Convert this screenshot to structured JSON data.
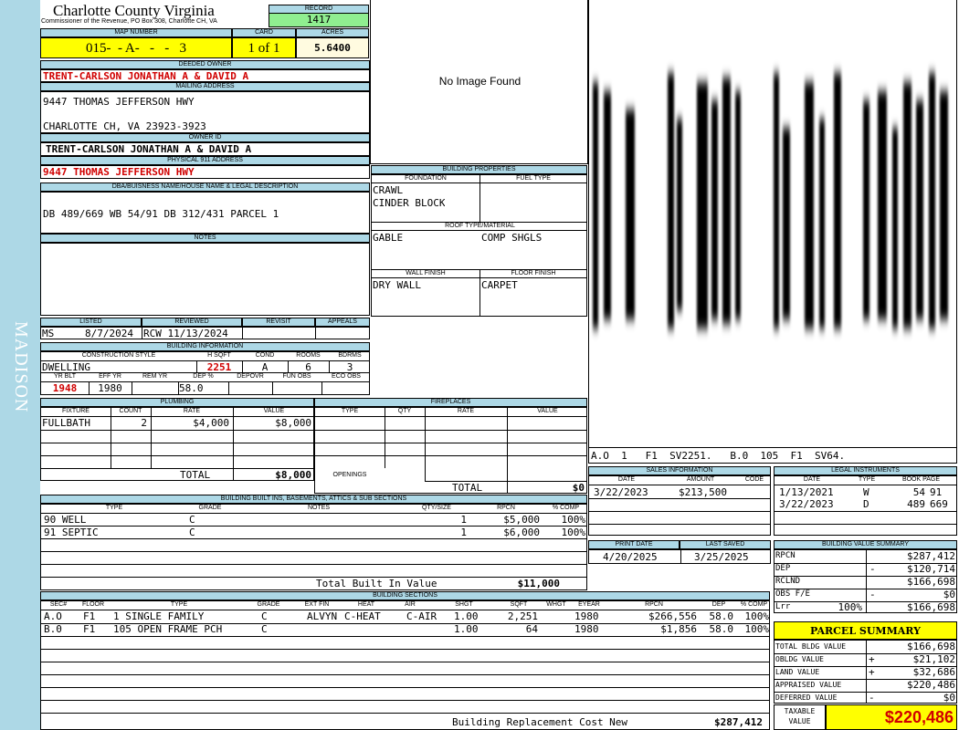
{
  "side_label": "MADISON",
  "header": {
    "county": "Charlotte County Virginia",
    "commissioner": "Commissioner of the Revenue, PO Box 308, Charlotte CH, VA",
    "record_label": "RECORD",
    "record": "1417",
    "map_label": "MAP NUMBER",
    "map_number": "015-  - A-   -   -   3",
    "card_label": "CARD",
    "card": "1 of 1",
    "acres_label": "ACRES",
    "acres": "5.6400"
  },
  "owner": {
    "deeded_label": "DEEDED OWNER",
    "deeded_owner": "TRENT-CARLSON JONATHAN A & DAVID A",
    "mailing_label": "MAILING ADDRESS",
    "mailing_line1": "9447 THOMAS JEFFERSON HWY",
    "mailing_line2": "CHARLOTTE CH, VA 23923-3923",
    "owner_id_label": "OWNER ID",
    "owner_id": "TRENT-CARLSON JONATHAN A & DAVID A",
    "physical_label": "PHYSICAL 911 ADDRESS",
    "physical_address": "9447 THOMAS JEFFERSON HWY"
  },
  "dba": {
    "label": "DBA/BUISNESS NAME/HOUSE NAME & LEGAL DESCRIPTION",
    "text": "DB 489/669 WB 54/91 DB 312/431 PARCEL 1"
  },
  "notes": {
    "label": "NOTES",
    "text": ""
  },
  "image": {
    "text": "No Image Found"
  },
  "building_properties": {
    "label": "BUILDING PROPERTIES",
    "foundation_label": "FOUNDATION",
    "foundation_line1": "CRAWL",
    "foundation_line2": "CINDER BLOCK",
    "fuel_label": "FUEL TYPE",
    "roof_label": "ROOF TYPE/MATERIAL",
    "roof_type": "GABLE",
    "roof_material": "COMP SHGLS",
    "wall_label": "WALL FINISH",
    "wall": "DRY WALL",
    "floor_label": "FLOOR FINISH",
    "floor": "CARPET"
  },
  "sketch": {
    "caption": "A.O  1   F1  SV2251.   B.0  105  F1  SV64."
  },
  "listing": {
    "listed_label": "LISTED",
    "listed_by": "MS",
    "listed_date": "8/7/2024",
    "reviewed_label": "REVIEWED",
    "reviewed": "RCW 11/13/2024",
    "revisit_label": "REVISIT",
    "appeals_label": "APPEALS"
  },
  "building_info": {
    "label": "BUILDING INFORMATION",
    "h_construction": "CONSTRUCTION STYLE",
    "h_sqft": "H SQFT",
    "h_cond": "COND",
    "h_rooms": "ROOMS",
    "h_bdrms": "BDRMS",
    "construction": "DWELLING",
    "sqft": "2251",
    "cond": "A",
    "rooms": "6",
    "bdrms": "3",
    "h_yrblt": "YR BLT",
    "h_effyr": "EFF YR",
    "h_remyr": "REM YR",
    "h_dep": "DEP %",
    "h_depovr": "DEPOVR",
    "h_funobs": "FUN OBS",
    "h_ecoobs": "ECO OBS",
    "yrblt": "1948",
    "effyr": "1980",
    "dep": "58.0"
  },
  "plumbing": {
    "label": "PLUMBING",
    "h_fixture": "FIXTURE",
    "h_count": "COUNT",
    "h_rate": "RATE",
    "h_value": "VALUE",
    "rows": [
      {
        "fixture": "FULLBATH",
        "count": "2",
        "rate": "$4,000",
        "value": "$8,000"
      }
    ],
    "total_label": "TOTAL",
    "total": "$8,000"
  },
  "fireplaces": {
    "label": "FIREPLACES",
    "h_type": "TYPE",
    "h_qty": "QTY",
    "h_rate": "RATE",
    "h_value": "VALUE",
    "openings_label": "OPENINGS",
    "total_label": "TOTAL",
    "total": "$0"
  },
  "sales": {
    "label": "SALES INFORMATION",
    "h_date": "DATE",
    "h_amount": "AMOUNT",
    "h_code": "CODE",
    "date": "3/22/2023",
    "amount": "$213,500"
  },
  "legal": {
    "label": "LEGAL INSTRUMENTS",
    "h_date": "DATE",
    "h_type": "TYPE",
    "h_bookpage": "BOOK PAGE",
    "rows": [
      {
        "date": "1/13/2021",
        "type": "W",
        "book": "54",
        "page": "91"
      },
      {
        "date": "3/22/2023",
        "type": "D",
        "book": "489",
        "page": "669"
      }
    ]
  },
  "built_ins": {
    "label": "BUILDING BUILT INS, BASEMENTS, ATTICS & SUB SECTIONS",
    "h_type": "TYPE",
    "h_grade": "GRADE",
    "h_notes": "NOTES",
    "h_qty": "QTY/SIZE",
    "h_rpcn": "RPCN",
    "h_comp": "% COMP",
    "rows": [
      {
        "type": "90 WELL",
        "grade": "C",
        "qty": "1",
        "rpcn": "$5,000",
        "comp": "100%"
      },
      {
        "type": "91 SEPTIC",
        "grade": "C",
        "qty": "1",
        "rpcn": "$6,000",
        "comp": "100%"
      }
    ],
    "total_label": "Total Built In Value",
    "total": "$11,000"
  },
  "print_info": {
    "print_label": "PRINT DATE",
    "print_date": "4/20/2025",
    "saved_label": "LAST SAVED",
    "saved_date": "3/25/2025"
  },
  "value_summary": {
    "label": "BUILDING VALUE SUMMARY",
    "rows": [
      {
        "label": "RPCN",
        "sign": "",
        "value": "$287,412"
      },
      {
        "label": "DEP",
        "sign": "-",
        "value": "$120,714"
      },
      {
        "label": "RCLND",
        "sign": "",
        "value": "$166,698"
      },
      {
        "label": "OBS F/E",
        "sign": "-",
        "value": "$0"
      },
      {
        "label": "Lrr",
        "pct": "100%",
        "sign": "",
        "value": "$166,698"
      }
    ]
  },
  "sections": {
    "label": "BUILDING SECTIONS",
    "headers": [
      "SEC#",
      "FLOOR",
      "TYPE",
      "GRADE",
      "EXT FIN",
      "HEAT",
      "AIR",
      "SHGT",
      "SQFT",
      "WHGT",
      "EYEAR",
      "RPCN",
      "DEP",
      "% COMP"
    ],
    "rows": [
      {
        "sec": "A.O",
        "floor": "F1",
        "type": "1 SINGLE FAMILY",
        "grade": "C",
        "ext": "ALVYN",
        "heat": "C-HEAT",
        "air": "C-AIR",
        "shgt": "1.00",
        "sqft": "2,251",
        "whgt": "",
        "eyear": "1980",
        "rpcn": "$266,556",
        "dep": "58.0",
        "comp": "100%"
      },
      {
        "sec": "B.0",
        "floor": "F1",
        "type": "105 OPEN FRAME PCH",
        "grade": "C",
        "ext": "",
        "heat": "",
        "air": "",
        "shgt": "1.00",
        "sqft": "64",
        "whgt": "",
        "eyear": "1980",
        "rpcn": "$1,856",
        "dep": "58.0",
        "comp": "100%"
      }
    ],
    "total_label": "Building Replacement Cost New",
    "total": "$287,412"
  },
  "parcel_summary": {
    "label": "PARCEL SUMMARY",
    "rows": [
      {
        "label": "TOTAL BLDG VALUE",
        "sign": "",
        "value": "$166,698"
      },
      {
        "label": "OBLDG VALUE",
        "sign": "+",
        "value": "$21,102"
      },
      {
        "label": "LAND VALUE",
        "sign": "+",
        "value": "$32,686"
      },
      {
        "label": "APPRAISED VALUE",
        "sign": "",
        "value": "$220,486"
      },
      {
        "label": "DEFERRED VALUE",
        "sign": "-",
        "value": "$0"
      }
    ],
    "taxable_label_1": "TAXABLE",
    "taxable_label_2": "VALUE",
    "taxable": "$220,486"
  },
  "colors": {
    "header_bg": "#add8e6",
    "highlight": "#ffff00",
    "record_bg": "#90ee90",
    "side_bg": "#add8e6",
    "red_text": "#d00000"
  }
}
